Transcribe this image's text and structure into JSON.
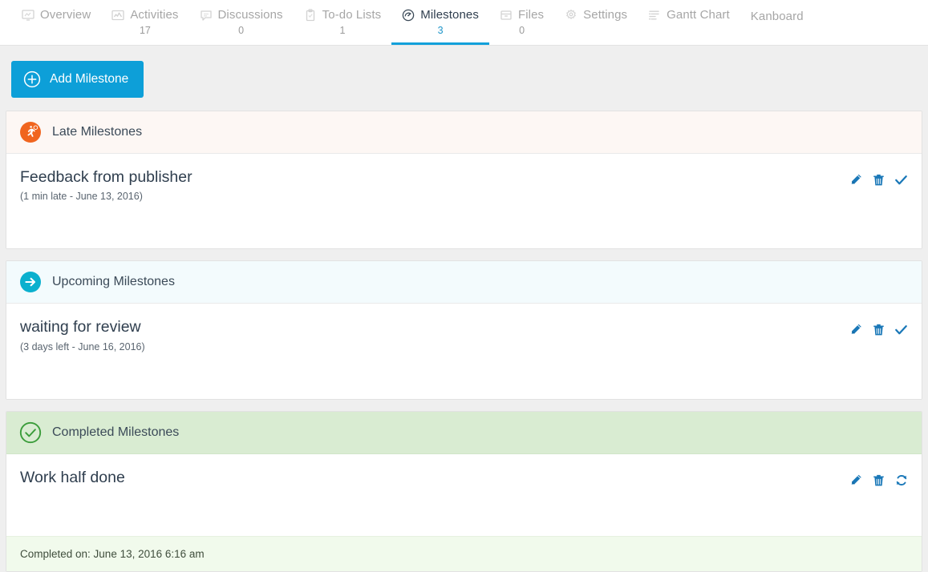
{
  "tabs": [
    {
      "label": "Overview",
      "count": "",
      "icon": "overview-monitor-icon",
      "active": false
    },
    {
      "label": "Activities",
      "count": "17",
      "icon": "activities-chart-icon",
      "active": false
    },
    {
      "label": "Discussions",
      "count": "0",
      "icon": "discussions-comment-icon",
      "active": false
    },
    {
      "label": "To-do Lists",
      "count": "1",
      "icon": "todo-clipboard-icon",
      "active": false
    },
    {
      "label": "Milestones",
      "count": "3",
      "icon": "milestones-gauge-icon",
      "active": true
    },
    {
      "label": "Files",
      "count": "0",
      "icon": "files-box-icon",
      "active": false
    },
    {
      "label": "Settings",
      "count": "",
      "icon": "settings-gear-icon",
      "active": false
    },
    {
      "label": "Gantt Chart",
      "count": "",
      "icon": "gantt-chart-icon",
      "active": false
    },
    {
      "label": "Kanboard",
      "count": "",
      "icon": "",
      "active": false
    }
  ],
  "toolbar": {
    "add_milestone_label": "Add Milestone",
    "add_icon": "plus-circle-icon",
    "accent_color": "#0d9fd8"
  },
  "sections": [
    {
      "key": "late",
      "title": "Late Milestones",
      "icon": "running-person-badge-icon",
      "icon_color": "#f0651f",
      "header_bg": "#fdf7f4",
      "milestone": {
        "name": "Feedback from publisher",
        "meta": "(1 min late - June 13, 2016)",
        "actions": [
          {
            "name": "edit-milestone-icon",
            "glyph": "pencil"
          },
          {
            "name": "delete-milestone-icon",
            "glyph": "trash"
          },
          {
            "name": "complete-milestone-icon",
            "glyph": "check"
          }
        ]
      },
      "footer": ""
    },
    {
      "key": "upcoming",
      "title": "Upcoming Milestones",
      "icon": "arrow-right-circle-icon",
      "icon_color": "#0bb0ce",
      "header_bg": "#f3fbfd",
      "milestone": {
        "name": "waiting for review",
        "meta": "(3 days left - June 16, 2016)",
        "actions": [
          {
            "name": "edit-milestone-icon",
            "glyph": "pencil"
          },
          {
            "name": "delete-milestone-icon",
            "glyph": "trash"
          },
          {
            "name": "complete-milestone-icon",
            "glyph": "check"
          }
        ]
      },
      "footer": ""
    },
    {
      "key": "completed",
      "title": "Completed Milestones",
      "icon": "check-circle-outline-icon",
      "icon_color": "#3a9c3a",
      "header_bg": "#d9ecd2",
      "milestone": {
        "name": "Work half done",
        "meta": "",
        "actions": [
          {
            "name": "edit-milestone-icon",
            "glyph": "pencil"
          },
          {
            "name": "delete-milestone-icon",
            "glyph": "trash"
          },
          {
            "name": "reopen-milestone-icon",
            "glyph": "refresh"
          }
        ]
      },
      "footer": "Completed on: June 13, 2016 6:16 am"
    }
  ]
}
